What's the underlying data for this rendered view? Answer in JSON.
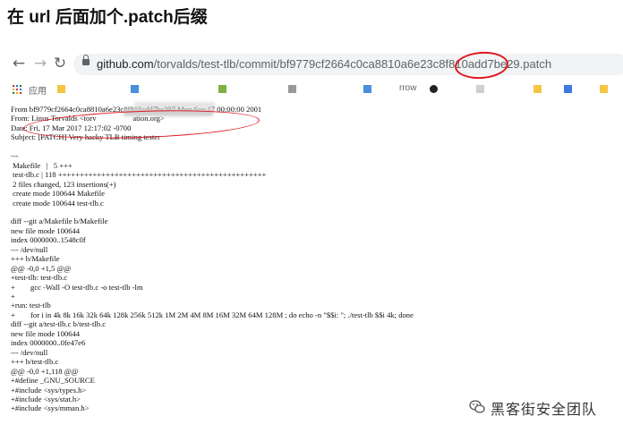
{
  "heading": "在 url 后面加个.patch后缀",
  "browser": {
    "nav": {
      "back_icon": "arrow-left-icon",
      "forward_icon": "arrow-right-icon",
      "reload_icon": "reload-icon"
    },
    "address": {
      "host": "github.com",
      "path": "/torvalds/test-tlb/commit/bf9779cf2664c0ca8810a6e23c8f810add7be29",
      "suffix": ".patch"
    },
    "bookmarks": {
      "apps_label": "应用",
      "items": [
        "",
        "",
        "",
        "",
        "",
        "rrow",
        ""
      ]
    }
  },
  "patch_lines": [
    "From bf9779cf2664c0ca8810a6e23c8f810add7be297 Mon Sep 17 00:00:00 2001",
    "From: Linus Torvalds <torv                   ation.org>",
    "Date: Fri, 17 Mar 2017 12:17:02 -0700",
    "Subject: [PATCH] Very hacky TLB timing tester",
    "",
    "---",
    " Makefile   |   5 +++",
    " test-tlb.c | 118 ++++++++++++++++++++++++++++++++++++++++++++++++",
    " 2 files changed, 123 insertions(+)",
    " create mode 100644 Makefile",
    " create mode 100644 test-tlb.c",
    "",
    "diff --git a/Makefile b/Makefile",
    "new file mode 100644",
    "index 0000000..1548c0f",
    "--- /dev/null",
    "+++ b/Makefile",
    "@@ -0,0 +1,5 @@",
    "+test-tlb: test-tlb.c",
    "+        gcc -Wall -O test-tlb.c -o test-tlb -lm",
    "+",
    "+run: test-tlb",
    "+        for i in 4k 8k 16k 32k 64k 128k 256k 512k 1M 2M 4M 8M 16M 32M 64M 128M ; do echo -n \"$$i: \"; ./test-tlb $$i 4k; done",
    "diff --git a/test-tlb.c b/test-tlb.c",
    "new file mode 100644",
    "index 0000000..0fe47e6",
    "--- /dev/null",
    "+++ b/test-tlb.c",
    "@@ -0,0 +1,118 @@",
    "+#define _GNU_SOURCE",
    "+#include <sys/types.h>",
    "+#include <sys/stat.h>",
    "+#include <sys/mman.h>"
  ],
  "watermark": {
    "icon": "wechat-icon",
    "text": "黑客街安全团队"
  },
  "colors": {
    "annotation_red": "#e0161c",
    "text": "#111111"
  }
}
